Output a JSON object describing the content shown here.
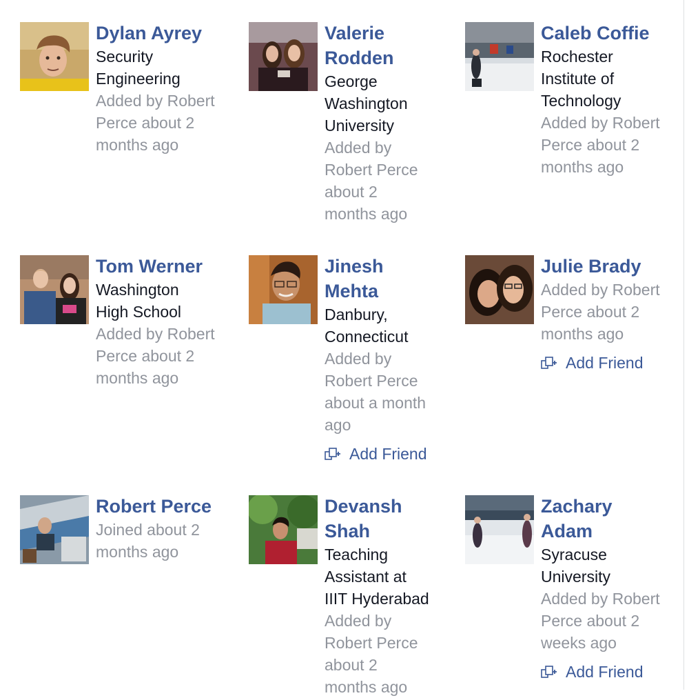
{
  "people": {
    "dylan": {
      "name": "Dylan Ayrey",
      "subtitle": "Security\nEngineering",
      "meta": "Added by Robert\nPerce about 2\nmonths ago"
    },
    "valerie": {
      "name": "Valerie\nRodden",
      "subtitle": "George\nWashington\nUniversity",
      "meta": "Added by\nRobert Perce\nabout 2\nmonths ago"
    },
    "caleb": {
      "name": "Caleb Coffie",
      "subtitle": "Rochester\nInstitute of\nTechnology",
      "meta": "Added by Robert\nPerce about 2\nmonths ago"
    },
    "tom": {
      "name": "Tom Werner",
      "subtitle": "Washington\nHigh School",
      "meta": "Added by Robert\nPerce about 2\nmonths ago"
    },
    "jinesh": {
      "name": "Jinesh\nMehta",
      "subtitle": "Danbury,\nConnecticut",
      "meta": "Added by\nRobert Perce\nabout a month\nago",
      "action": "Add Friend"
    },
    "julie": {
      "name": "Julie Brady",
      "meta": "Added by Robert\nPerce about 2\nmonths ago",
      "action": "Add Friend"
    },
    "robert": {
      "name": "Robert Perce",
      "meta": "Joined about 2\nmonths ago"
    },
    "devansh": {
      "name": "Devansh\nShah",
      "subtitle": "Teaching\nAssistant at\nIIIT Hyderabad",
      "meta": "Added by\nRobert Perce\nabout 2\nmonths ago"
    },
    "zachary": {
      "name": "Zachary\nAdam",
      "subtitle": "Syracuse\nUniversity",
      "meta": "Added by Robert\nPerce about 2\nweeks ago",
      "action": "Add Friend"
    }
  },
  "icons": {
    "add_friend": "add-friend-icon"
  },
  "colors": {
    "link": "#3b5998",
    "text": "#141823",
    "meta": "#90949c"
  }
}
